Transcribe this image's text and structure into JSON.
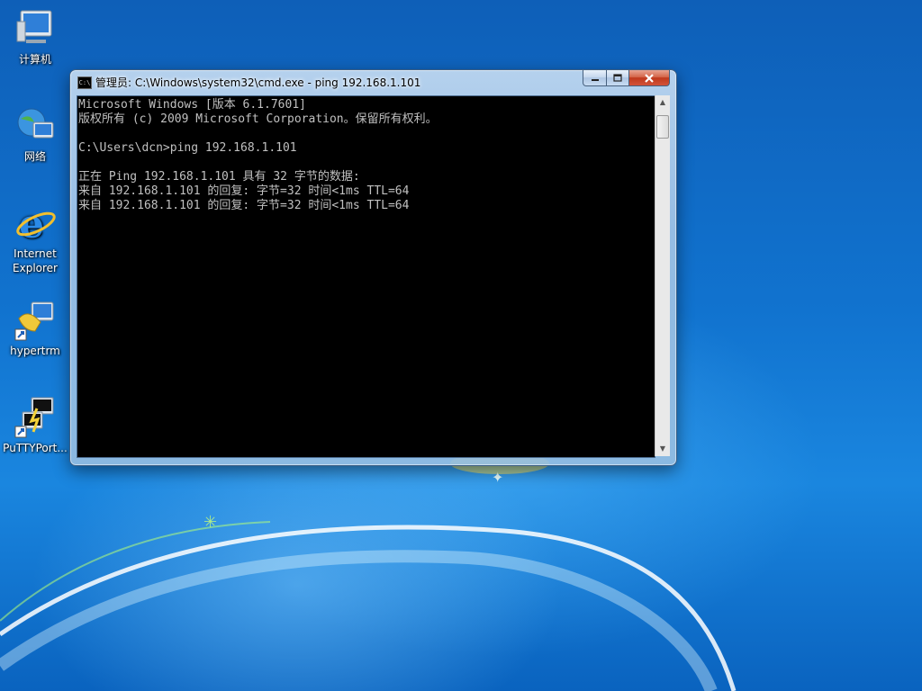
{
  "desktop": {
    "icons": [
      {
        "label": "计算机",
        "icon": "computer-icon"
      },
      {
        "label": "网络",
        "icon": "network-icon"
      },
      {
        "label": "Internet Explorer",
        "icon": "internet-explorer-icon"
      },
      {
        "label": "hypertrm",
        "icon": "hyperterminal-icon"
      },
      {
        "label": "PuTTYPort...",
        "icon": "putty-icon"
      }
    ]
  },
  "window": {
    "title": "管理员: C:\\Windows\\system32\\cmd.exe - ping  192.168.1.101",
    "app_icon_text": "C:\\",
    "console_lines": [
      "Microsoft Windows [版本 6.1.7601]",
      "版权所有 (c) 2009 Microsoft Corporation。保留所有权利。",
      "",
      "C:\\Users\\dcn>ping 192.168.1.101",
      "",
      "正在 Ping 192.168.1.101 具有 32 字节的数据:",
      "来自 192.168.1.101 的回复: 字节=32 时间<1ms TTL=64",
      "来自 192.168.1.101 的回复: 字节=32 时间<1ms TTL=64"
    ]
  },
  "colors": {
    "console_background": "#000000",
    "console_text": "#c0c0c0",
    "close_button": "#c0391c"
  }
}
